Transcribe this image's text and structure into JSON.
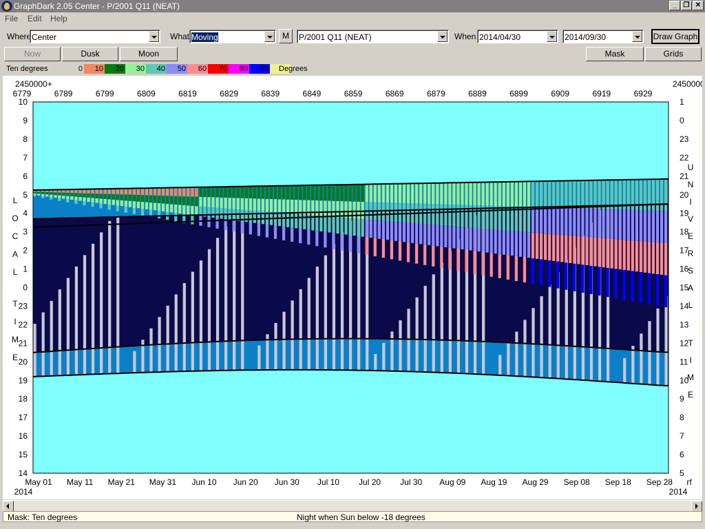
{
  "window": {
    "title": "GraphDark 2.05  Center  -  P/2001 Q11 (NEAT)",
    "buttons": {
      "minimize": "_",
      "restore": "❐",
      "close": "✕"
    }
  },
  "menu": {
    "items": [
      {
        "label": "File"
      },
      {
        "label": "Edit"
      },
      {
        "label": "Help"
      }
    ]
  },
  "toolbar": {
    "where_label": "Where",
    "where_value": "Center",
    "what_label": "What",
    "what_value": "Moving",
    "m_button": "M",
    "object_value": "P/2001 Q11 (NEAT)",
    "when_label": "When",
    "start_date": "2014/04/30",
    "end_date": "2014/09/30",
    "draw_button": "Draw Graph"
  },
  "toolbar2": {
    "now": "Now",
    "dusk": "Dusk",
    "moon": "Moon",
    "mask": "Mask",
    "grids": "Grids"
  },
  "legend": {
    "label": "Ten degrees",
    "unit": "Degrees",
    "swatches": [
      {
        "text": "0",
        "color": "#d4d0c8"
      },
      {
        "text": "10",
        "color": "#f08a60"
      },
      {
        "text": "20",
        "color": "#0a7a12"
      },
      {
        "text": "30",
        "color": "#96f096"
      },
      {
        "text": "40",
        "color": "#5ec8b4"
      },
      {
        "text": "50",
        "color": "#8c8cff"
      },
      {
        "text": "60",
        "color": "#ff8c8c"
      },
      {
        "text": "70",
        "color": "#ff0000"
      },
      {
        "text": "80",
        "color": "#ff00ff"
      },
      {
        "text": "90",
        "color": "#0000ff"
      },
      {
        "text": "",
        "color": "#f0f08c"
      }
    ]
  },
  "chart_data": {
    "type": "heatmap",
    "x_epoch_label": "2450000+",
    "jd_ticks": [
      "6779",
      "6789",
      "6799",
      "6809",
      "6819",
      "6829",
      "6839",
      "6849",
      "6859",
      "6869",
      "6879",
      "6889",
      "6899",
      "6909",
      "6919",
      "6929"
    ],
    "date_ticks": [
      "May 01",
      "May 11",
      "May 21",
      "May 31",
      "Jun 10",
      "Jun 20",
      "Jun 30",
      "Jul 10",
      "Jul 20",
      "Jul 30",
      "Aug 09",
      "Aug 19",
      "Aug 29",
      "Sep 08",
      "Sep 18",
      "Sep 28"
    ],
    "year_left": "2014",
    "year_right": "2014",
    "left_axis_title": "LOCAL TIME",
    "right_axis_title": "UNIVERSAL TIME",
    "left_ticks": [
      "10",
      "9",
      "8",
      "7",
      "6",
      "5",
      "4",
      "3",
      "2",
      "1",
      "0",
      "23",
      "22",
      "21",
      "20",
      "19",
      "18",
      "17",
      "16",
      "15",
      "14"
    ],
    "right_ticks": [
      "1",
      "0",
      "23",
      "22",
      "21",
      "20",
      "19",
      "18",
      "17",
      "16",
      "15",
      "14",
      "13",
      "12",
      "11",
      "10",
      "9",
      "8",
      "7",
      "6",
      "5"
    ],
    "corner_right_bottom": "rf",
    "colors": {
      "day": "#80ffff",
      "night": "#0a0a4a",
      "twilight": "#0a80c8",
      "moon": "#c8c8d4",
      "alt10": "#f08a60",
      "alt20": "#0a7a12",
      "alt30": "#96f096",
      "alt40": "#5ec8b4",
      "alt50": "#8c8cff",
      "alt60": "#ff8c8c",
      "alt90": "#0000ff"
    }
  },
  "status": {
    "left": "Mask:  Ten degrees",
    "center": "Night when Sun below -18 degrees"
  }
}
